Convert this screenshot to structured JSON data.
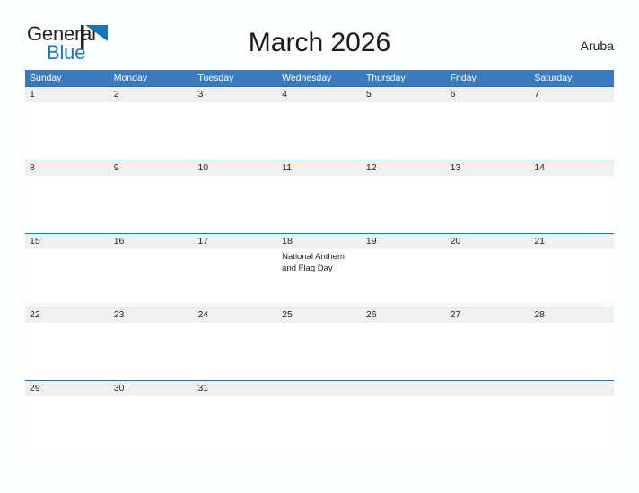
{
  "brand": {
    "name_part1": "General",
    "name_part2": "Blue",
    "flag_icon": "blue-flag-triangle-icon",
    "color_dark": "#231f20",
    "color_blue": "#1b75bb"
  },
  "header": {
    "title": "March 2026",
    "region": "Aruba"
  },
  "theme": {
    "header_blue": "#3a7bbf",
    "row_border_blue": "#2e6da4",
    "daynum_band_gray": "#f0f0f0",
    "page_background": "#fcfdfe",
    "text_color": "#231f20"
  },
  "calendar": {
    "weekdays": [
      "Sunday",
      "Monday",
      "Tuesday",
      "Wednesday",
      "Thursday",
      "Friday",
      "Saturday"
    ],
    "weeks": [
      {
        "days": [
          {
            "number": "1",
            "event": ""
          },
          {
            "number": "2",
            "event": ""
          },
          {
            "number": "3",
            "event": ""
          },
          {
            "number": "4",
            "event": ""
          },
          {
            "number": "5",
            "event": ""
          },
          {
            "number": "6",
            "event": ""
          },
          {
            "number": "7",
            "event": ""
          }
        ]
      },
      {
        "days": [
          {
            "number": "8",
            "event": ""
          },
          {
            "number": "9",
            "event": ""
          },
          {
            "number": "10",
            "event": ""
          },
          {
            "number": "11",
            "event": ""
          },
          {
            "number": "12",
            "event": ""
          },
          {
            "number": "13",
            "event": ""
          },
          {
            "number": "14",
            "event": ""
          }
        ]
      },
      {
        "days": [
          {
            "number": "15",
            "event": ""
          },
          {
            "number": "16",
            "event": ""
          },
          {
            "number": "17",
            "event": ""
          },
          {
            "number": "18",
            "event": "National Anthem and Flag Day"
          },
          {
            "number": "19",
            "event": ""
          },
          {
            "number": "20",
            "event": ""
          },
          {
            "number": "21",
            "event": ""
          }
        ]
      },
      {
        "days": [
          {
            "number": "22",
            "event": ""
          },
          {
            "number": "23",
            "event": ""
          },
          {
            "number": "24",
            "event": ""
          },
          {
            "number": "25",
            "event": ""
          },
          {
            "number": "26",
            "event": ""
          },
          {
            "number": "27",
            "event": ""
          },
          {
            "number": "28",
            "event": ""
          }
        ]
      },
      {
        "days": [
          {
            "number": "29",
            "event": ""
          },
          {
            "number": "30",
            "event": ""
          },
          {
            "number": "31",
            "event": ""
          },
          {
            "number": "",
            "event": ""
          },
          {
            "number": "",
            "event": ""
          },
          {
            "number": "",
            "event": ""
          },
          {
            "number": "",
            "event": ""
          }
        ]
      }
    ]
  }
}
